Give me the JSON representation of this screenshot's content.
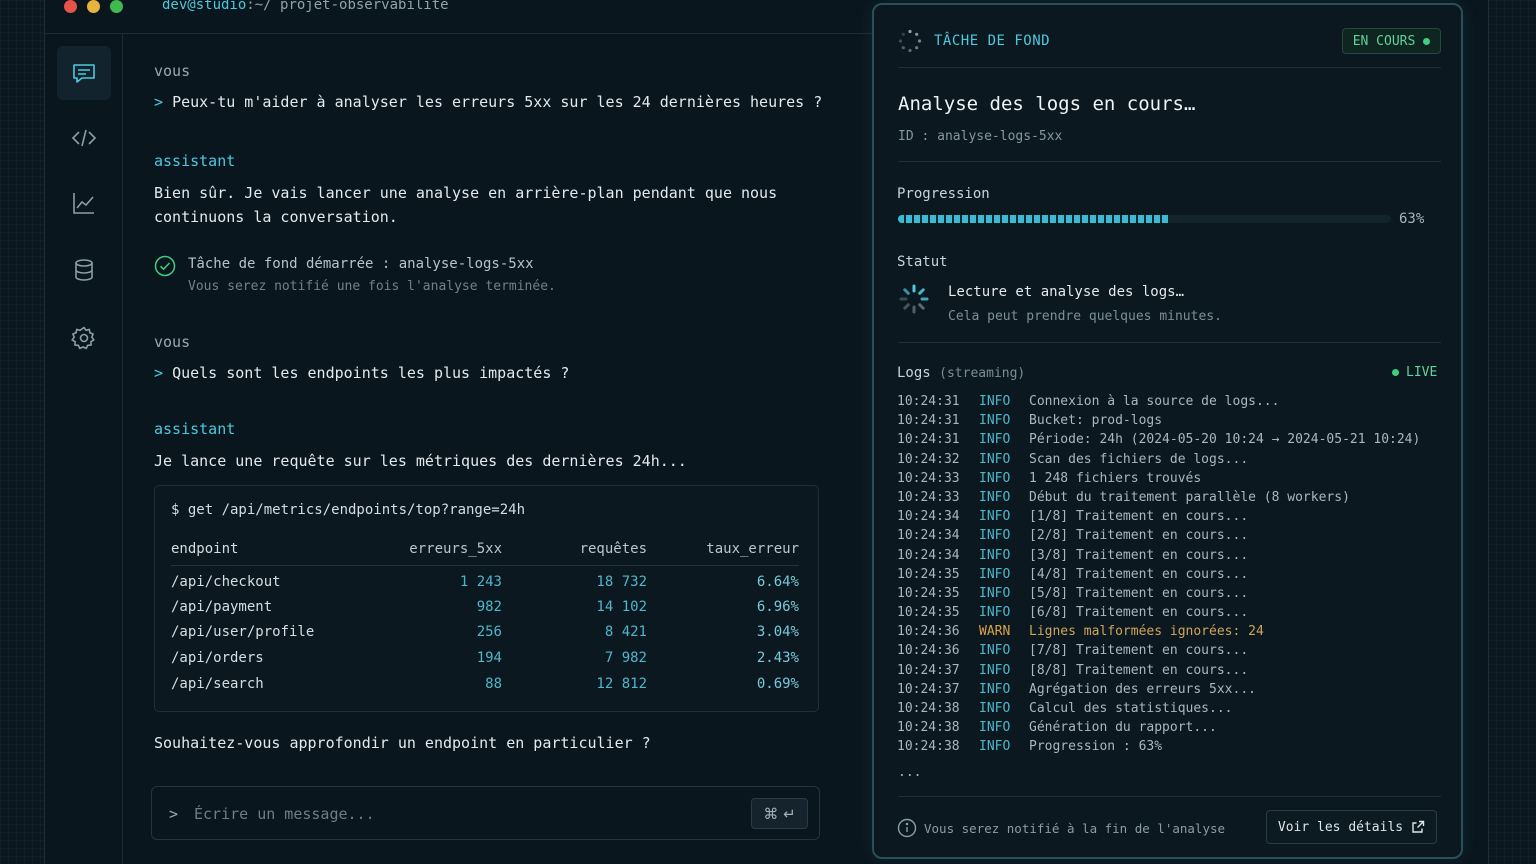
{
  "window": {
    "user_host": "dev@studio",
    "path": ":~/ projet-observabilite"
  },
  "sidebar": {
    "items": [
      {
        "icon": "chat-icon",
        "active": true
      },
      {
        "icon": "code-icon"
      },
      {
        "icon": "chart-icon"
      },
      {
        "icon": "database-icon"
      },
      {
        "icon": "gear-icon"
      }
    ]
  },
  "chat": {
    "messages": [
      {
        "role": "vous",
        "prompt": ">",
        "text": "Peux-tu m'aider à analyser les erreurs 5xx sur les 24 dernières heures ?"
      },
      {
        "role": "assistant",
        "line1": "Bien sûr. Je vais lancer une analyse en arrière-plan pendant que nous",
        "line2": "continuons la conversation."
      },
      {
        "role": "vous",
        "prompt": ">",
        "text": "Quels sont les endpoints les plus impactés ?"
      },
      {
        "role": "assistant",
        "text": "Je lance une requête sur les métriques des dernières 24h..."
      }
    ],
    "task_note": {
      "title": "Tâche de fond démarrée : analyse-logs-5xx",
      "subtitle": "Vous serez notifié une fois l'analyse terminée."
    },
    "command": "$ get /api/metrics/endpoints/top?range=24h",
    "table": {
      "headers": [
        "endpoint",
        "erreurs_5xx",
        "requêtes",
        "taux_erreur"
      ],
      "rows": [
        [
          "/api/checkout",
          "1 243",
          "18 732",
          "6.64%"
        ],
        [
          "/api/payment",
          "982",
          "14 102",
          "6.96%"
        ],
        [
          "/api/user/profile",
          "256",
          "8 421",
          "3.04%"
        ],
        [
          "/api/orders",
          "194",
          "7 982",
          "2.43%"
        ],
        [
          "/api/search",
          "88",
          "12 812",
          "0.69%"
        ]
      ]
    },
    "followup": "Souhaitez-vous approfondir un endpoint en particulier ?",
    "input": {
      "caret": ">",
      "placeholder": "Écrire un message...",
      "value": "",
      "shortcut": "⌘ ↵"
    }
  },
  "panel": {
    "header": "TÂCHE DE FOND",
    "badge": "EN COURS",
    "title": "Analyse des logs en cours…",
    "id_label": "ID : analyse-logs-5xx",
    "progress_label": "Progression",
    "progress_value": 0.55,
    "progress_pct": "63%",
    "status_label": "Statut",
    "status_main": "Lecture et analyse des logs…",
    "status_sub": "Cela peut prendre quelques minutes.",
    "logs_label": "Logs",
    "logs_sub": "(streaming)",
    "live": "LIVE",
    "logs": [
      {
        "t": "10:24:31",
        "lv": "INFO",
        "m": "Connexion à la source de logs..."
      },
      {
        "t": "10:24:31",
        "lv": "INFO",
        "m": "Bucket: prod-logs"
      },
      {
        "t": "10:24:31",
        "lv": "INFO",
        "m": "Période: 24h (2024-05-20 10:24  → 2024-05-21 10:24)"
      },
      {
        "t": "10:24:32",
        "lv": "INFO",
        "m": "Scan des fichiers de logs..."
      },
      {
        "t": "10:24:33",
        "lv": "INFO",
        "m": "1 248 fichiers trouvés"
      },
      {
        "t": "10:24:33",
        "lv": "INFO",
        "m": "Début du traitement parallèle (8 workers)"
      },
      {
        "t": "10:24:34",
        "lv": "INFO",
        "m": "[1/8] Traitement en cours..."
      },
      {
        "t": "10:24:34",
        "lv": "INFO",
        "m": "[2/8] Traitement en cours..."
      },
      {
        "t": "10:24:34",
        "lv": "INFO",
        "m": "[3/8] Traitement en cours..."
      },
      {
        "t": "10:24:35",
        "lv": "INFO",
        "m": "[4/8] Traitement en cours..."
      },
      {
        "t": "10:24:35",
        "lv": "INFO",
        "m": "[5/8] Traitement en cours..."
      },
      {
        "t": "10:24:35",
        "lv": "INFO",
        "m": "[6/8] Traitement en cours..."
      },
      {
        "t": "10:24:36",
        "lv": "WARN",
        "m": "Lignes malformées ignorées: 24"
      },
      {
        "t": "10:24:36",
        "lv": "INFO",
        "m": "[7/8] Traitement en cours..."
      },
      {
        "t": "10:24:37",
        "lv": "INFO",
        "m": "[8/8] Traitement en cours..."
      },
      {
        "t": "10:24:37",
        "lv": "INFO",
        "m": "Agrégation des erreurs 5xx..."
      },
      {
        "t": "10:24:38",
        "lv": "INFO",
        "m": "Calcul des statistiques..."
      },
      {
        "t": "10:24:38",
        "lv": "INFO",
        "m": "Génération du rapport..."
      },
      {
        "t": "10:24:38",
        "lv": "INFO",
        "m": "Progression : 63%"
      }
    ],
    "ellipsis": "...",
    "footer_note": "Vous serez notifié à la fin de l'analyse",
    "details_button": "Voir les détails"
  },
  "colors": {
    "accent": "#4cc9dd",
    "live": "#3fcf7f",
    "warn": "#d9a24a"
  }
}
